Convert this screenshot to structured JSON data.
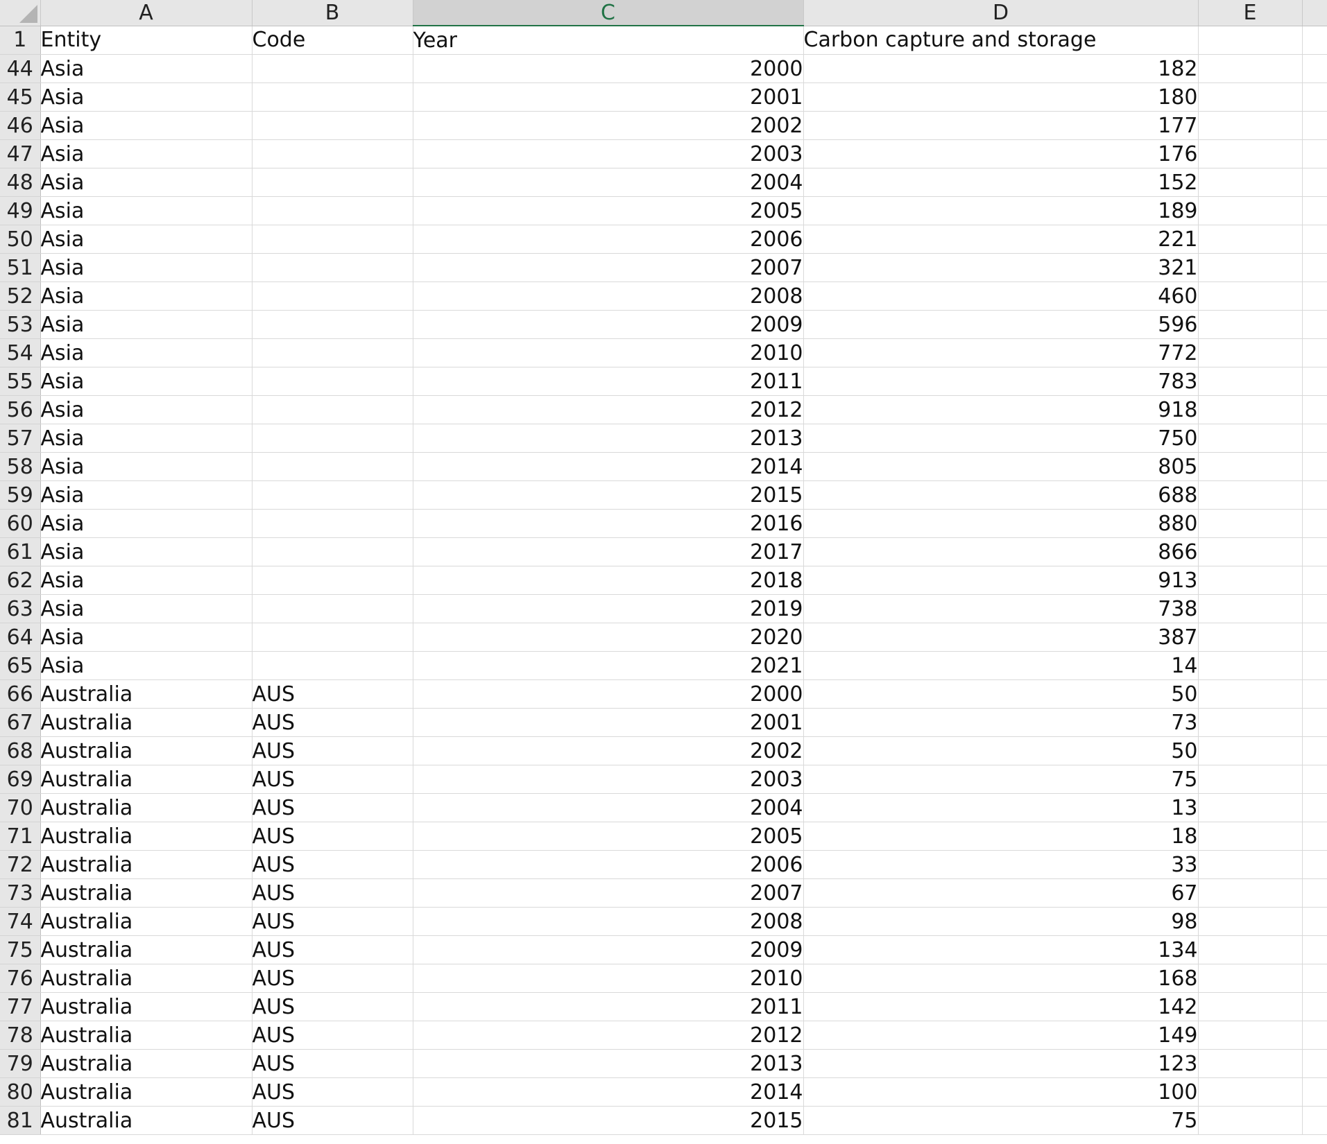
{
  "columns": [
    "A",
    "B",
    "C",
    "D",
    "E"
  ],
  "selected_column": "C",
  "header_row": {
    "row_number": "1",
    "cells": [
      "Entity",
      "Code",
      "Year",
      "Carbon capture and storage",
      ""
    ]
  },
  "rows": [
    {
      "n": "44",
      "entity": "Asia",
      "code": "",
      "year": "2000",
      "value": "182"
    },
    {
      "n": "45",
      "entity": "Asia",
      "code": "",
      "year": "2001",
      "value": "180"
    },
    {
      "n": "46",
      "entity": "Asia",
      "code": "",
      "year": "2002",
      "value": "177"
    },
    {
      "n": "47",
      "entity": "Asia",
      "code": "",
      "year": "2003",
      "value": "176"
    },
    {
      "n": "48",
      "entity": "Asia",
      "code": "",
      "year": "2004",
      "value": "152"
    },
    {
      "n": "49",
      "entity": "Asia",
      "code": "",
      "year": "2005",
      "value": "189"
    },
    {
      "n": "50",
      "entity": "Asia",
      "code": "",
      "year": "2006",
      "value": "221"
    },
    {
      "n": "51",
      "entity": "Asia",
      "code": "",
      "year": "2007",
      "value": "321"
    },
    {
      "n": "52",
      "entity": "Asia",
      "code": "",
      "year": "2008",
      "value": "460"
    },
    {
      "n": "53",
      "entity": "Asia",
      "code": "",
      "year": "2009",
      "value": "596"
    },
    {
      "n": "54",
      "entity": "Asia",
      "code": "",
      "year": "2010",
      "value": "772"
    },
    {
      "n": "55",
      "entity": "Asia",
      "code": "",
      "year": "2011",
      "value": "783"
    },
    {
      "n": "56",
      "entity": "Asia",
      "code": "",
      "year": "2012",
      "value": "918"
    },
    {
      "n": "57",
      "entity": "Asia",
      "code": "",
      "year": "2013",
      "value": "750"
    },
    {
      "n": "58",
      "entity": "Asia",
      "code": "",
      "year": "2014",
      "value": "805"
    },
    {
      "n": "59",
      "entity": "Asia",
      "code": "",
      "year": "2015",
      "value": "688"
    },
    {
      "n": "60",
      "entity": "Asia",
      "code": "",
      "year": "2016",
      "value": "880"
    },
    {
      "n": "61",
      "entity": "Asia",
      "code": "",
      "year": "2017",
      "value": "866"
    },
    {
      "n": "62",
      "entity": "Asia",
      "code": "",
      "year": "2018",
      "value": "913"
    },
    {
      "n": "63",
      "entity": "Asia",
      "code": "",
      "year": "2019",
      "value": "738"
    },
    {
      "n": "64",
      "entity": "Asia",
      "code": "",
      "year": "2020",
      "value": "387"
    },
    {
      "n": "65",
      "entity": "Asia",
      "code": "",
      "year": "2021",
      "value": "14"
    },
    {
      "n": "66",
      "entity": "Australia",
      "code": "AUS",
      "year": "2000",
      "value": "50"
    },
    {
      "n": "67",
      "entity": "Australia",
      "code": "AUS",
      "year": "2001",
      "value": "73"
    },
    {
      "n": "68",
      "entity": "Australia",
      "code": "AUS",
      "year": "2002",
      "value": "50"
    },
    {
      "n": "69",
      "entity": "Australia",
      "code": "AUS",
      "year": "2003",
      "value": "75"
    },
    {
      "n": "70",
      "entity": "Australia",
      "code": "AUS",
      "year": "2004",
      "value": "13"
    },
    {
      "n": "71",
      "entity": "Australia",
      "code": "AUS",
      "year": "2005",
      "value": "18"
    },
    {
      "n": "72",
      "entity": "Australia",
      "code": "AUS",
      "year": "2006",
      "value": "33"
    },
    {
      "n": "73",
      "entity": "Australia",
      "code": "AUS",
      "year": "2007",
      "value": "67"
    },
    {
      "n": "74",
      "entity": "Australia",
      "code": "AUS",
      "year": "2008",
      "value": "98"
    },
    {
      "n": "75",
      "entity": "Australia",
      "code": "AUS",
      "year": "2009",
      "value": "134"
    },
    {
      "n": "76",
      "entity": "Australia",
      "code": "AUS",
      "year": "2010",
      "value": "168"
    },
    {
      "n": "77",
      "entity": "Australia",
      "code": "AUS",
      "year": "2011",
      "value": "142"
    },
    {
      "n": "78",
      "entity": "Australia",
      "code": "AUS",
      "year": "2012",
      "value": "149"
    },
    {
      "n": "79",
      "entity": "Australia",
      "code": "AUS",
      "year": "2013",
      "value": "123"
    },
    {
      "n": "80",
      "entity": "Australia",
      "code": "AUS",
      "year": "2014",
      "value": "100"
    },
    {
      "n": "81",
      "entity": "Australia",
      "code": "AUS",
      "year": "2015",
      "value": "75"
    }
  ],
  "colors": {
    "header_bg": "#e6e6e6",
    "selected_header_bg": "#d2d2d2",
    "selected_accent": "#217346",
    "gridline": "#d9d9d9"
  }
}
